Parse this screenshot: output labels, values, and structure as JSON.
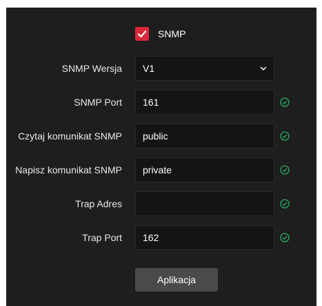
{
  "snmp": {
    "label": "SNMP",
    "enabled": true
  },
  "fields": {
    "version": {
      "label": "SNMP Wersja",
      "value": "V1"
    },
    "port": {
      "label": "SNMP Port",
      "value": "161"
    },
    "read": {
      "label": "Czytaj komunikat SNMP",
      "value": "public"
    },
    "write": {
      "label": "Napisz komunikat SNMP",
      "value": "private"
    },
    "trap_addr": {
      "label": "Trap Adres",
      "value": ""
    },
    "trap_port": {
      "label": "Trap Port",
      "value": "162"
    }
  },
  "apply_label": "Aplikacja",
  "colors": {
    "background": "#1e1e1e",
    "checkbox": "#d9293a",
    "valid_icon": "#27ae60",
    "button": "#4a4a4a"
  },
  "icons": {
    "checkbox": "checkmark-icon",
    "select": "chevron-down-icon",
    "valid": "check-circle-icon"
  }
}
